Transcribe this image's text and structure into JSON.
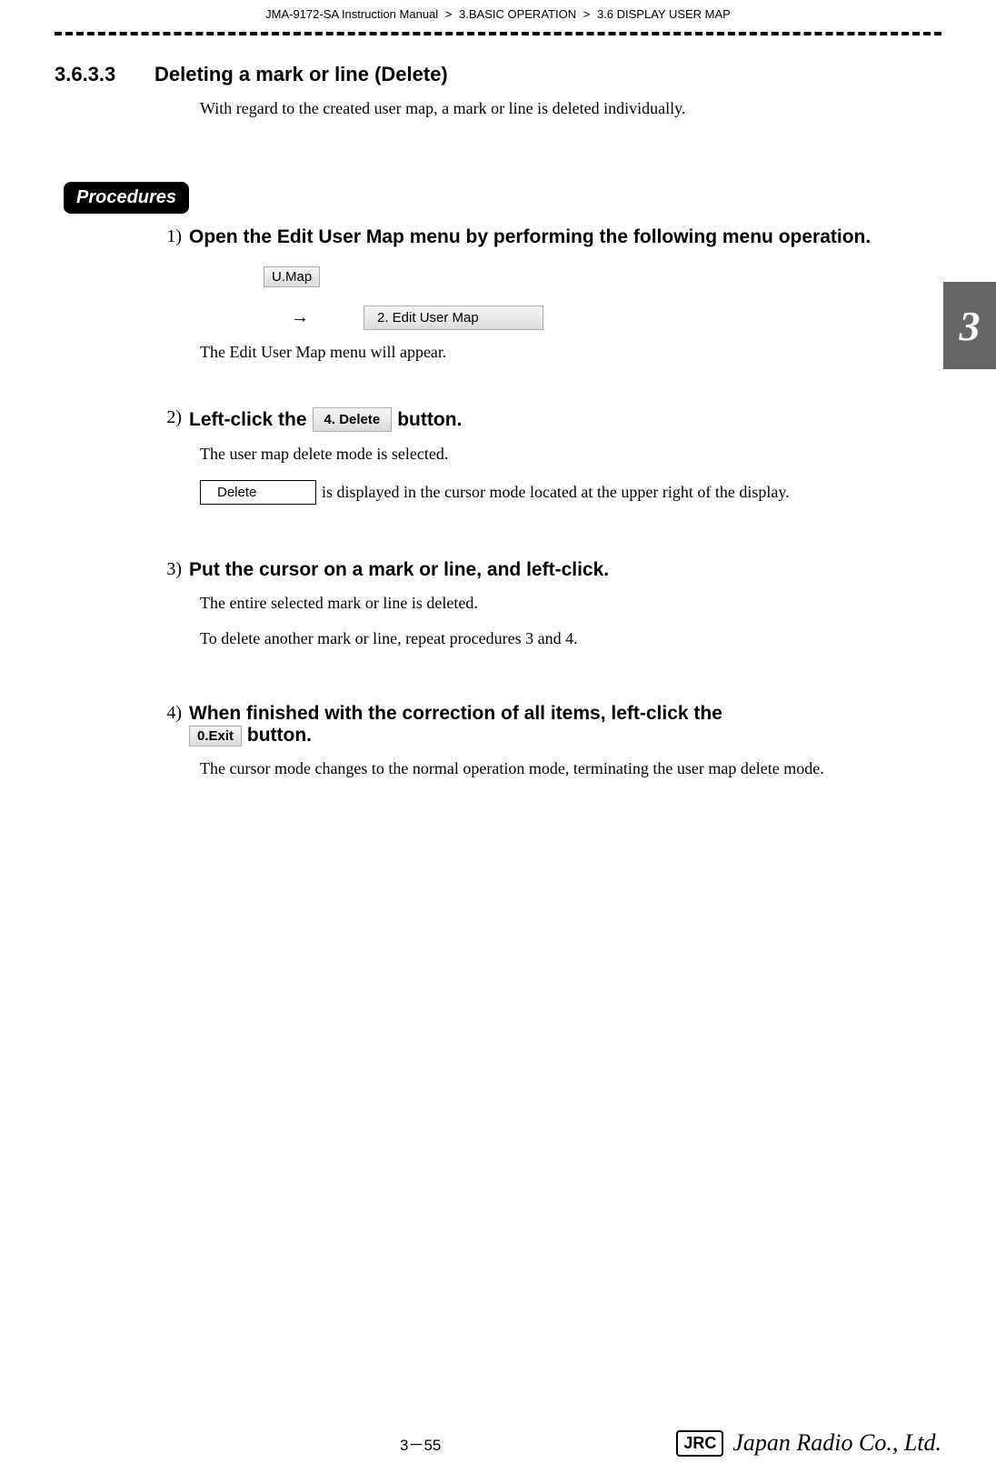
{
  "breadcrumb": {
    "part1": "JMA-9172-SA Instruction Manual",
    "part2": "3.BASIC OPERATION",
    "part3": "3.6  DISPLAY USER MAP",
    "sep": ">"
  },
  "section": {
    "number": "3.6.3.3",
    "title": "Deleting a mark or line (Delete)"
  },
  "intro": "With regard to the created user map, a mark or line is deleted individually.",
  "procedures_label": "Procedures",
  "steps": {
    "s1": {
      "num": "1)",
      "heading": "Open the Edit User Map menu by performing the following menu operation.",
      "button_umap": "U.Map",
      "arrow": "→",
      "button_edit": "2. Edit User Map",
      "after": "The Edit User Map menu will appear."
    },
    "s2": {
      "num": "2)",
      "heading_pre": "Left-click the ",
      "button_delete4": "4. Delete",
      "heading_post": " button.",
      "line1": "The user map delete mode is selected.",
      "box_delete": "Delete",
      "line2_rest": " is displayed in the cursor mode located at the upper right of the display."
    },
    "s3": {
      "num": "3)",
      "heading": "Put the cursor on a mark or line, and left-click.",
      "line1": "The entire selected mark or line is deleted.",
      "line2": "To delete another mark or line, repeat procedures 3 and 4."
    },
    "s4": {
      "num": "4)",
      "heading_pre": "When finished with the correction of all items, left-click the ",
      "button_exit": "0.Exit",
      "heading_post": " button.",
      "line1": "The cursor mode changes to the normal operation mode, terminating the user map delete mode."
    }
  },
  "side_tab": "3",
  "footer": {
    "page_number": "3－55",
    "logo_box": "JRC",
    "company": "Japan Radio Co., Ltd."
  }
}
